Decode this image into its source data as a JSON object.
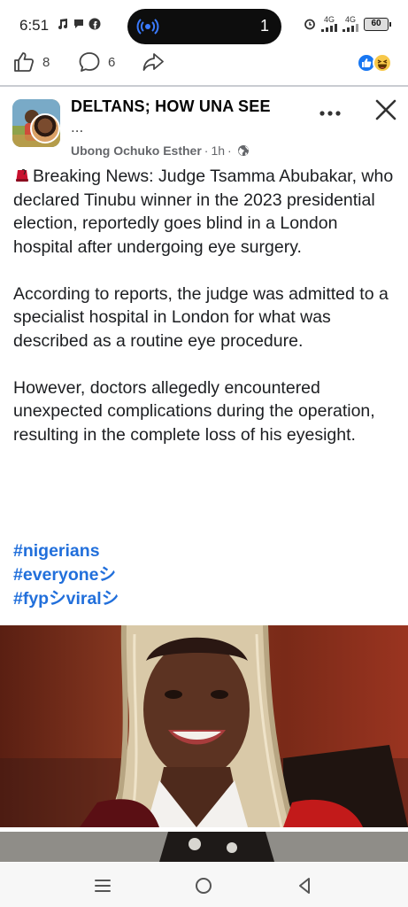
{
  "status_bar": {
    "time": "6:51",
    "pill_count": "1",
    "signal_labels": [
      "4G",
      "4G"
    ],
    "battery": "60"
  },
  "reactions": {
    "likes": "8",
    "comments": "6"
  },
  "post": {
    "group_name": "DELTANS; HOW UNA SEE",
    "group_ellipsis": "...",
    "author": "Ubong Ochuko Esther",
    "time": "1h",
    "paragraphs": [
      "Breaking News: Judge Tsamma Abubakar, who declared Tinubu winner in the 2023 presidential election, reportedly goes blind in a London hospital after undergoing eye surgery.",
      "According to reports, the judge was admitted to a specialist hospital in London for what was described as a routine eye procedure.",
      "However, doctors allegedly encountered unexpected complications during the operation, resulting in the complete loss of his eyesight."
    ],
    "hashtags": [
      "#nigerians",
      "#everyoneシ",
      "#fypシviralシ"
    ]
  },
  "colors": {
    "hashtag": "#216fdb",
    "like_blue": "#1877f2",
    "secondary_text": "#65676b"
  },
  "icons": [
    "music-note-icon",
    "chat-bubble-icon",
    "facebook-icon",
    "broadcast-icon",
    "alarm-icon",
    "signal-icon",
    "battery-icon",
    "like-icon",
    "comment-icon",
    "share-icon",
    "more-icon",
    "close-icon",
    "globe-icon",
    "menu-icon",
    "home-icon",
    "back-icon"
  ]
}
